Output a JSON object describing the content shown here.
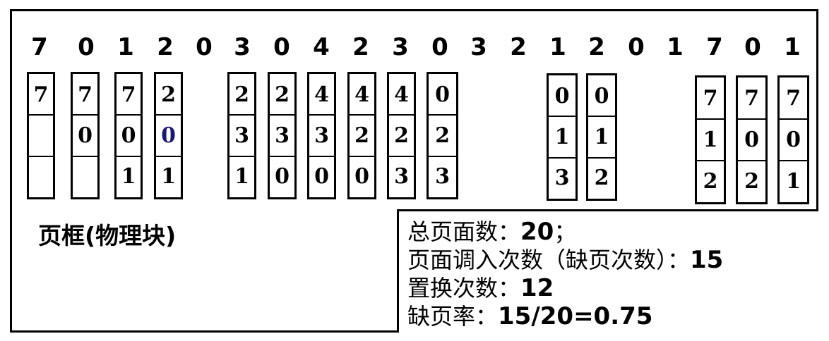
{
  "reference_string": [
    "7",
    "0",
    "1",
    "2",
    "0",
    "3",
    "0",
    "4",
    "2",
    "3",
    "0",
    "3",
    "2",
    "1",
    "2",
    "0",
    "1",
    "7",
    "0",
    "1"
  ],
  "frames": [
    {
      "cells": [
        "7",
        "",
        ""
      ]
    },
    {
      "cells": [
        "7",
        "0",
        ""
      ]
    },
    {
      "cells": [
        "7",
        "0",
        "1"
      ]
    },
    {
      "cells": [
        "2",
        "0",
        "1"
      ],
      "highlight": 1
    },
    {
      "cells": [
        "2",
        "3",
        "1"
      ]
    },
    {
      "cells": [
        "2",
        "3",
        "0"
      ]
    },
    {
      "cells": [
        "4",
        "3",
        "0"
      ]
    },
    {
      "cells": [
        "4",
        "2",
        "0"
      ]
    },
    {
      "cells": [
        "4",
        "2",
        "3"
      ]
    },
    {
      "cells": [
        "0",
        "2",
        "3"
      ]
    },
    {
      "cells": [
        "0",
        "1",
        "3"
      ]
    },
    {
      "cells": [
        "0",
        "1",
        "2"
      ]
    },
    {
      "cells": [
        "7",
        "1",
        "2"
      ]
    },
    {
      "cells": [
        "7",
        "0",
        "2"
      ]
    },
    {
      "cells": [
        "7",
        "0",
        "1"
      ]
    }
  ],
  "frame_label": "页框(物理块)",
  "stats": {
    "total_label": "总页面数：",
    "total_value": "20",
    "total_suffix": "；",
    "faults_label": "页面调入次数（缺页次数）：",
    "faults_value": "15",
    "replacements_label": "置换次数：",
    "replacements_value": "12",
    "rate_label": "缺页率：",
    "rate_value": "15/20=0.75"
  },
  "colors": {
    "highlight": "#1a1a6e",
    "border": "#000000"
  }
}
